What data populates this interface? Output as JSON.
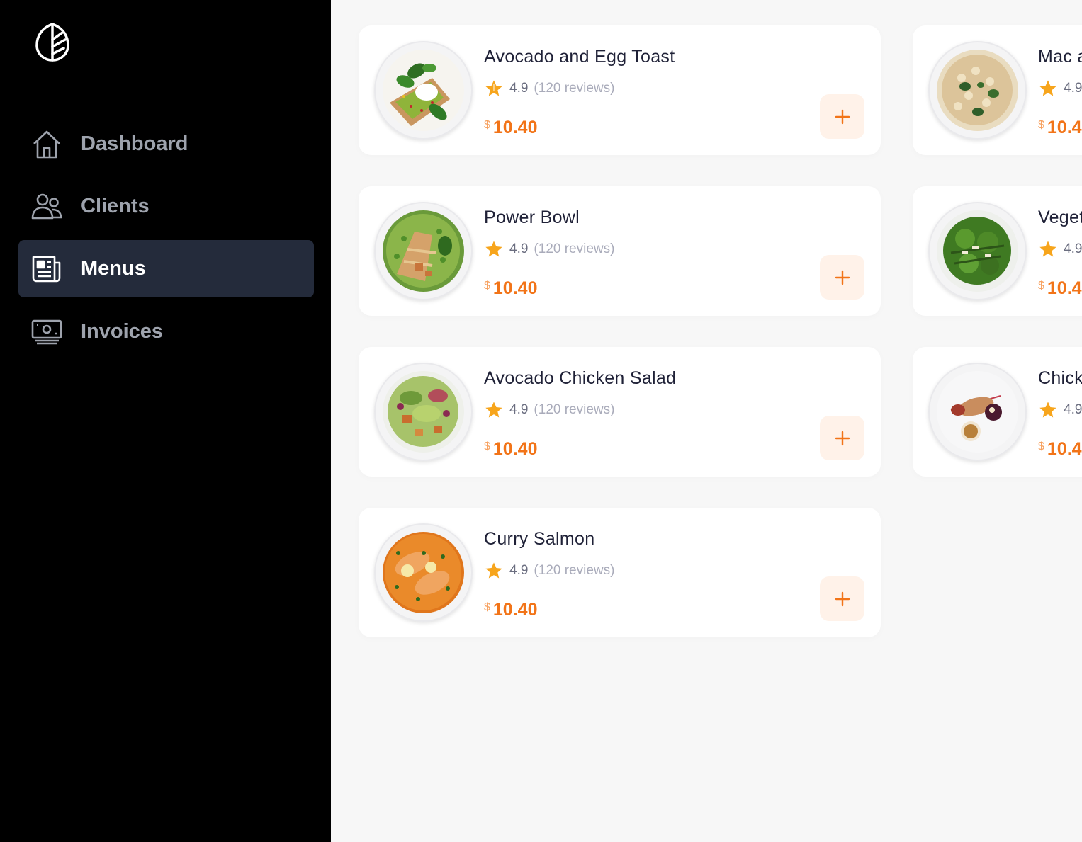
{
  "sidebar": {
    "logo_icon": "leaf-logo-icon",
    "items": [
      {
        "label": "Dashboard",
        "icon": "home-icon",
        "active": false
      },
      {
        "label": "Clients",
        "icon": "users-icon",
        "active": false
      },
      {
        "label": "Menus",
        "icon": "newspaper-icon",
        "active": true
      },
      {
        "label": "Invoices",
        "icon": "cash-icon",
        "active": false
      }
    ]
  },
  "menu_items": [
    {
      "title": "Avocado and Egg Toast",
      "rating": "4.9",
      "reviews": "(120 reviews)",
      "currency": "$",
      "price": "10.40",
      "image": "avocado-egg-toast"
    },
    {
      "title": "Mac a",
      "rating": "4.9",
      "reviews": "",
      "currency": "$",
      "price": "10.4",
      "image": "mac-and-cheese"
    },
    {
      "title": "Power Bowl",
      "rating": "4.9",
      "reviews": "(120 reviews)",
      "currency": "$",
      "price": "10.40",
      "image": "power-bowl"
    },
    {
      "title": "Veget",
      "rating": "4.9",
      "reviews": "",
      "currency": "$",
      "price": "10.4",
      "image": "vegetable-salad"
    },
    {
      "title": "Avocado Chicken Salad",
      "rating": "4.9",
      "reviews": "(120 reviews)",
      "currency": "$",
      "price": "10.40",
      "image": "avocado-chicken-salad"
    },
    {
      "title": "Chick",
      "rating": "4.9",
      "reviews": "",
      "currency": "$",
      "price": "10.4",
      "image": "chicken-plate"
    },
    {
      "title": "Curry Salmon",
      "rating": "4.9",
      "reviews": "(120 reviews)",
      "currency": "$",
      "price": "10.40",
      "image": "curry-salmon"
    }
  ],
  "colors": {
    "sidebar_bg": "#000000",
    "active_nav_bg": "#242b3b",
    "accent": "#f27418",
    "star": "#f7a51c",
    "add_button_bg": "#fff2e9"
  }
}
